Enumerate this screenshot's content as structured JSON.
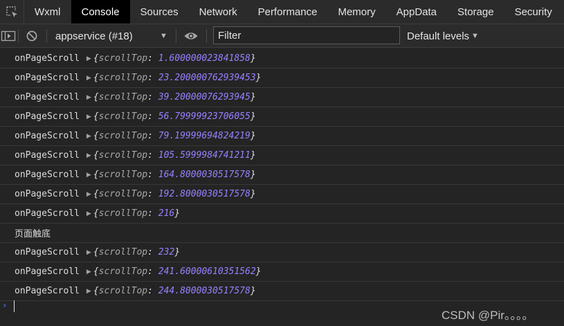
{
  "tabs": [
    {
      "label": "Wxml",
      "active": false
    },
    {
      "label": "Console",
      "active": true
    },
    {
      "label": "Sources",
      "active": false
    },
    {
      "label": "Network",
      "active": false
    },
    {
      "label": "Performance",
      "active": false
    },
    {
      "label": "Memory",
      "active": false
    },
    {
      "label": "AppData",
      "active": false
    },
    {
      "label": "Storage",
      "active": false
    },
    {
      "label": "Security",
      "active": false
    }
  ],
  "toolbar": {
    "context": "appservice (#18)",
    "filter_placeholder": "Filter",
    "levels": "Default levels",
    "dropdown_glyph": "▼"
  },
  "console": {
    "entries": [
      {
        "fn": "onPageScroll",
        "key": "scrollTop",
        "value": "1.600000023841858"
      },
      {
        "fn": "onPageScroll",
        "key": "scrollTop",
        "value": "23.200000762939453"
      },
      {
        "fn": "onPageScroll",
        "key": "scrollTop",
        "value": "39.20000076293945"
      },
      {
        "fn": "onPageScroll",
        "key": "scrollTop",
        "value": "56.79999923706055"
      },
      {
        "fn": "onPageScroll",
        "key": "scrollTop",
        "value": "79.19999694824219"
      },
      {
        "fn": "onPageScroll",
        "key": "scrollTop",
        "value": "105.5999984741211"
      },
      {
        "fn": "onPageScroll",
        "key": "scrollTop",
        "value": "164.8000030517578"
      },
      {
        "fn": "onPageScroll",
        "key": "scrollTop",
        "value": "192.8000030517578"
      },
      {
        "fn": "onPageScroll",
        "key": "scrollTop",
        "value": "216"
      },
      {
        "text": "页面触底"
      },
      {
        "fn": "onPageScroll",
        "key": "scrollTop",
        "value": "232"
      },
      {
        "fn": "onPageScroll",
        "key": "scrollTop",
        "value": "241.60000610351562"
      },
      {
        "fn": "onPageScroll",
        "key": "scrollTop",
        "value": "244.8000030517578"
      }
    ],
    "expand_glyph": "▶",
    "prompt_glyph": "›"
  },
  "watermark": "CSDN @Pir。。。。",
  "colors": {
    "panel_bg": "#242424",
    "toolbar_bg": "#2b2b2b",
    "active_tab_bg": "#000000",
    "number": "#9980ff",
    "prompt": "#4d8cff"
  },
  "icons": [
    "inspect-element-icon",
    "toggle-sidebar-icon",
    "clear-console-icon",
    "eye-icon",
    "expand-triangle-icon",
    "prompt-chevron-icon"
  ]
}
